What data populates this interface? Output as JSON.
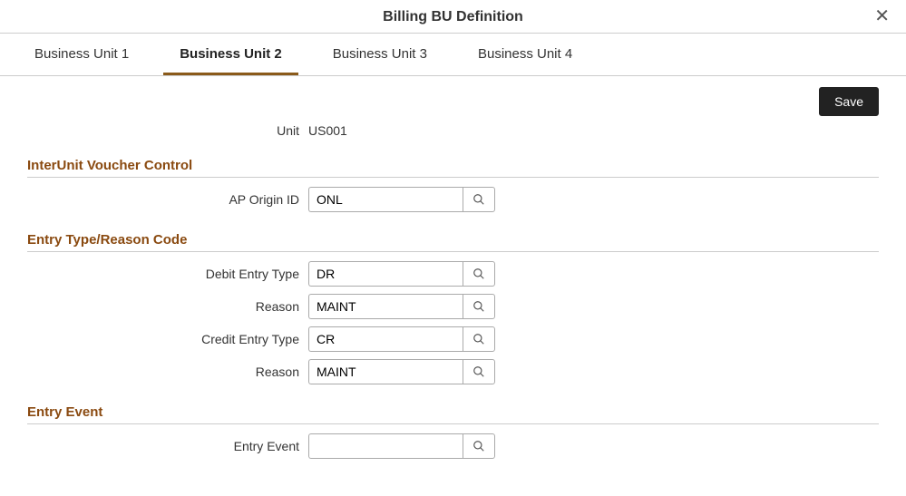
{
  "header": {
    "title": "Billing BU Definition"
  },
  "tabs": [
    {
      "label": "Business Unit 1",
      "active": false
    },
    {
      "label": "Business Unit 2",
      "active": true
    },
    {
      "label": "Business Unit 3",
      "active": false
    },
    {
      "label": "Business Unit 4",
      "active": false
    }
  ],
  "actions": {
    "save_label": "Save"
  },
  "unit": {
    "label": "Unit",
    "value": "US001"
  },
  "sections": {
    "interunit": {
      "title": "InterUnit Voucher Control",
      "ap_origin_id": {
        "label": "AP Origin ID",
        "value": "ONL"
      }
    },
    "entry_type": {
      "title": "Entry Type/Reason Code",
      "debit_entry_type": {
        "label": "Debit Entry Type",
        "value": "DR"
      },
      "debit_reason": {
        "label": "Reason",
        "value": "MAINT"
      },
      "credit_entry_type": {
        "label": "Credit Entry Type",
        "value": "CR"
      },
      "credit_reason": {
        "label": "Reason",
        "value": "MAINT"
      }
    },
    "entry_event": {
      "title": "Entry Event",
      "entry_event": {
        "label": "Entry Event",
        "value": ""
      }
    }
  }
}
